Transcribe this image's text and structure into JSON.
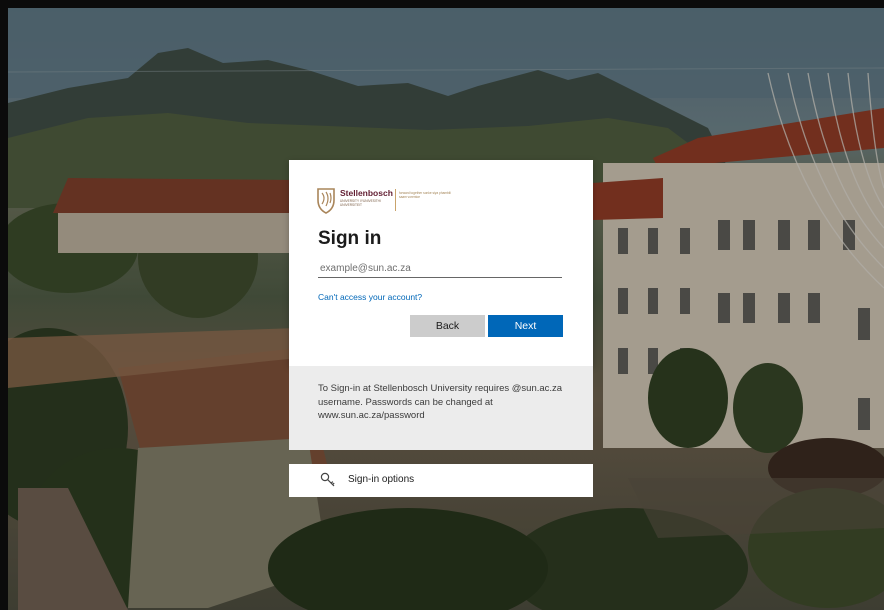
{
  "logo": {
    "name": "Stellenbosch",
    "sub": "UNIVERSITY IYUNIVESITHI UNIVERSITEIT",
    "tagline": "forward together sonke siya phambili saam vorentoe"
  },
  "signin": {
    "title": "Sign in",
    "email_placeholder": "example@sun.ac.za",
    "email_value": "",
    "cant_access": "Can't access your account?",
    "back_label": "Back",
    "next_label": "Next"
  },
  "info": {
    "text": "To Sign-in at Stellenbosch University requires @sun.ac.za username. Passwords can be changed at www.sun.ac.za/password"
  },
  "options": {
    "icon": "key-icon",
    "label": "Sign-in options"
  },
  "colors": {
    "accent": "#0067b8",
    "brand": "#611d31",
    "back_button": "#cccccc",
    "info_bg": "#ececec"
  }
}
